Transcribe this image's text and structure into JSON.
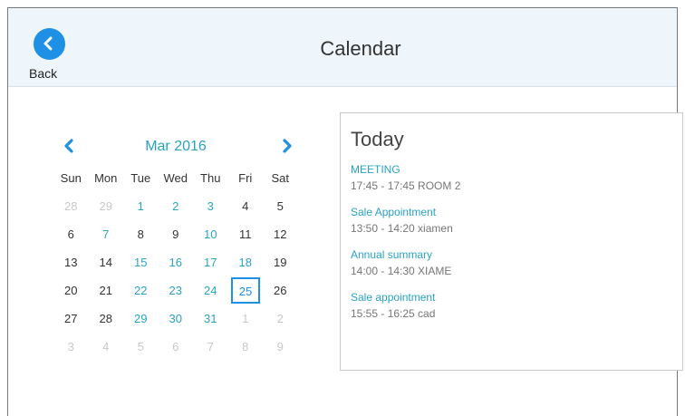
{
  "header": {
    "back_label": "Back",
    "title": "Calendar"
  },
  "calendar": {
    "month_label": "Mar 2016",
    "weekdays": [
      "Sun",
      "Mon",
      "Tue",
      "Wed",
      "Thu",
      "Fri",
      "Sat"
    ],
    "weeks": [
      [
        {
          "d": "28",
          "t": "other"
        },
        {
          "d": "29",
          "t": "other"
        },
        {
          "d": "1",
          "t": "hi"
        },
        {
          "d": "2",
          "t": "hi"
        },
        {
          "d": "3",
          "t": "hi"
        },
        {
          "d": "4",
          "t": "cur"
        },
        {
          "d": "5",
          "t": "cur"
        }
      ],
      [
        {
          "d": "6",
          "t": "cur"
        },
        {
          "d": "7",
          "t": "hi"
        },
        {
          "d": "8",
          "t": "cur"
        },
        {
          "d": "9",
          "t": "cur"
        },
        {
          "d": "10",
          "t": "hi"
        },
        {
          "d": "11",
          "t": "cur"
        },
        {
          "d": "12",
          "t": "cur"
        }
      ],
      [
        {
          "d": "13",
          "t": "cur"
        },
        {
          "d": "14",
          "t": "cur"
        },
        {
          "d": "15",
          "t": "hi"
        },
        {
          "d": "16",
          "t": "hi"
        },
        {
          "d": "17",
          "t": "hi"
        },
        {
          "d": "18",
          "t": "hi"
        },
        {
          "d": "19",
          "t": "cur"
        }
      ],
      [
        {
          "d": "20",
          "t": "cur"
        },
        {
          "d": "21",
          "t": "cur"
        },
        {
          "d": "22",
          "t": "hi"
        },
        {
          "d": "23",
          "t": "hi"
        },
        {
          "d": "24",
          "t": "hi"
        },
        {
          "d": "25",
          "t": "sel"
        },
        {
          "d": "26",
          "t": "cur"
        }
      ],
      [
        {
          "d": "27",
          "t": "cur"
        },
        {
          "d": "28",
          "t": "cur"
        },
        {
          "d": "29",
          "t": "hi"
        },
        {
          "d": "30",
          "t": "hi"
        },
        {
          "d": "31",
          "t": "hi"
        },
        {
          "d": "1",
          "t": "other"
        },
        {
          "d": "2",
          "t": "other"
        }
      ],
      [
        {
          "d": "3",
          "t": "other"
        },
        {
          "d": "4",
          "t": "other"
        },
        {
          "d": "5",
          "t": "other"
        },
        {
          "d": "6",
          "t": "other"
        },
        {
          "d": "7",
          "t": "other"
        },
        {
          "d": "8",
          "t": "other"
        },
        {
          "d": "9",
          "t": "other"
        }
      ]
    ]
  },
  "today": {
    "heading": "Today",
    "events": [
      {
        "title": "MEETING",
        "time": "17:45 - 17:45 ROOM 2"
      },
      {
        "title": "Sale Appointment",
        "time": "13:50 - 14:20 xiamen"
      },
      {
        "title": "Annual summary",
        "time": "14:00 - 14:30 XIAME"
      },
      {
        "title": "Sale appointment",
        "time": "15:55 - 16:25 cad"
      }
    ]
  },
  "colors": {
    "accent": "#1e90e6",
    "highlight_day": "#2aa3c3",
    "header_bg": "#eef6fb"
  },
  "icons": {
    "back": "chevron-left-icon",
    "prev": "chevron-left-icon",
    "next": "chevron-right-icon"
  }
}
